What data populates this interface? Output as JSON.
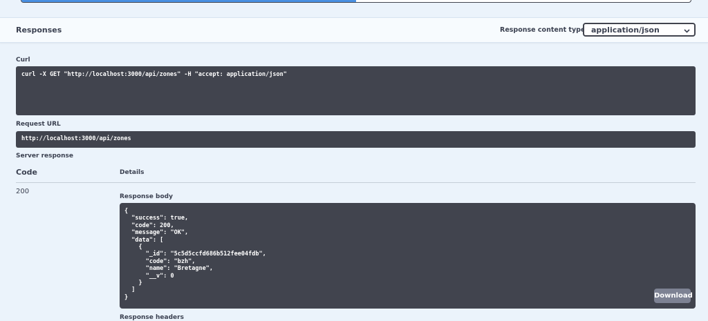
{
  "execute": {
    "progress_fraction": 0.5
  },
  "responses": {
    "title": "Responses",
    "content_type_label": "Response content type",
    "content_type_value": "application/json",
    "content_type_options": [
      "application/json"
    ]
  },
  "curl": {
    "label": "Curl",
    "command": "curl -X GET \"http://localhost:3000/api/zones\" -H \"accept: application/json\""
  },
  "request_url": {
    "label": "Request URL",
    "value": "http://localhost:3000/api/zones"
  },
  "server_response": {
    "label": "Server response",
    "col_code": "Code",
    "col_details": "Details",
    "status_code": "200",
    "body_label": "Response body",
    "body_lines": [
      "{",
      "  \"success\": true,",
      "  \"code\": 200,",
      "  \"message\": \"OK\",",
      "  \"data\": [",
      "    {",
      "      \"_id\": \"5c5d5ccfd686b512fee04fdb\",",
      "      \"code\": \"bzh\",",
      "      \"name\": \"Bretagne\",",
      "      \"__v\": 0",
      "    }",
      "  ]",
      "}"
    ],
    "download_label": "Download",
    "headers_label": "Response headers"
  },
  "colors": {
    "code_bg": "#41444e",
    "accent": "#4990e2",
    "download_bg": "#7d8293"
  },
  "icons": {
    "select_chevron": "chevron-down-icon"
  }
}
